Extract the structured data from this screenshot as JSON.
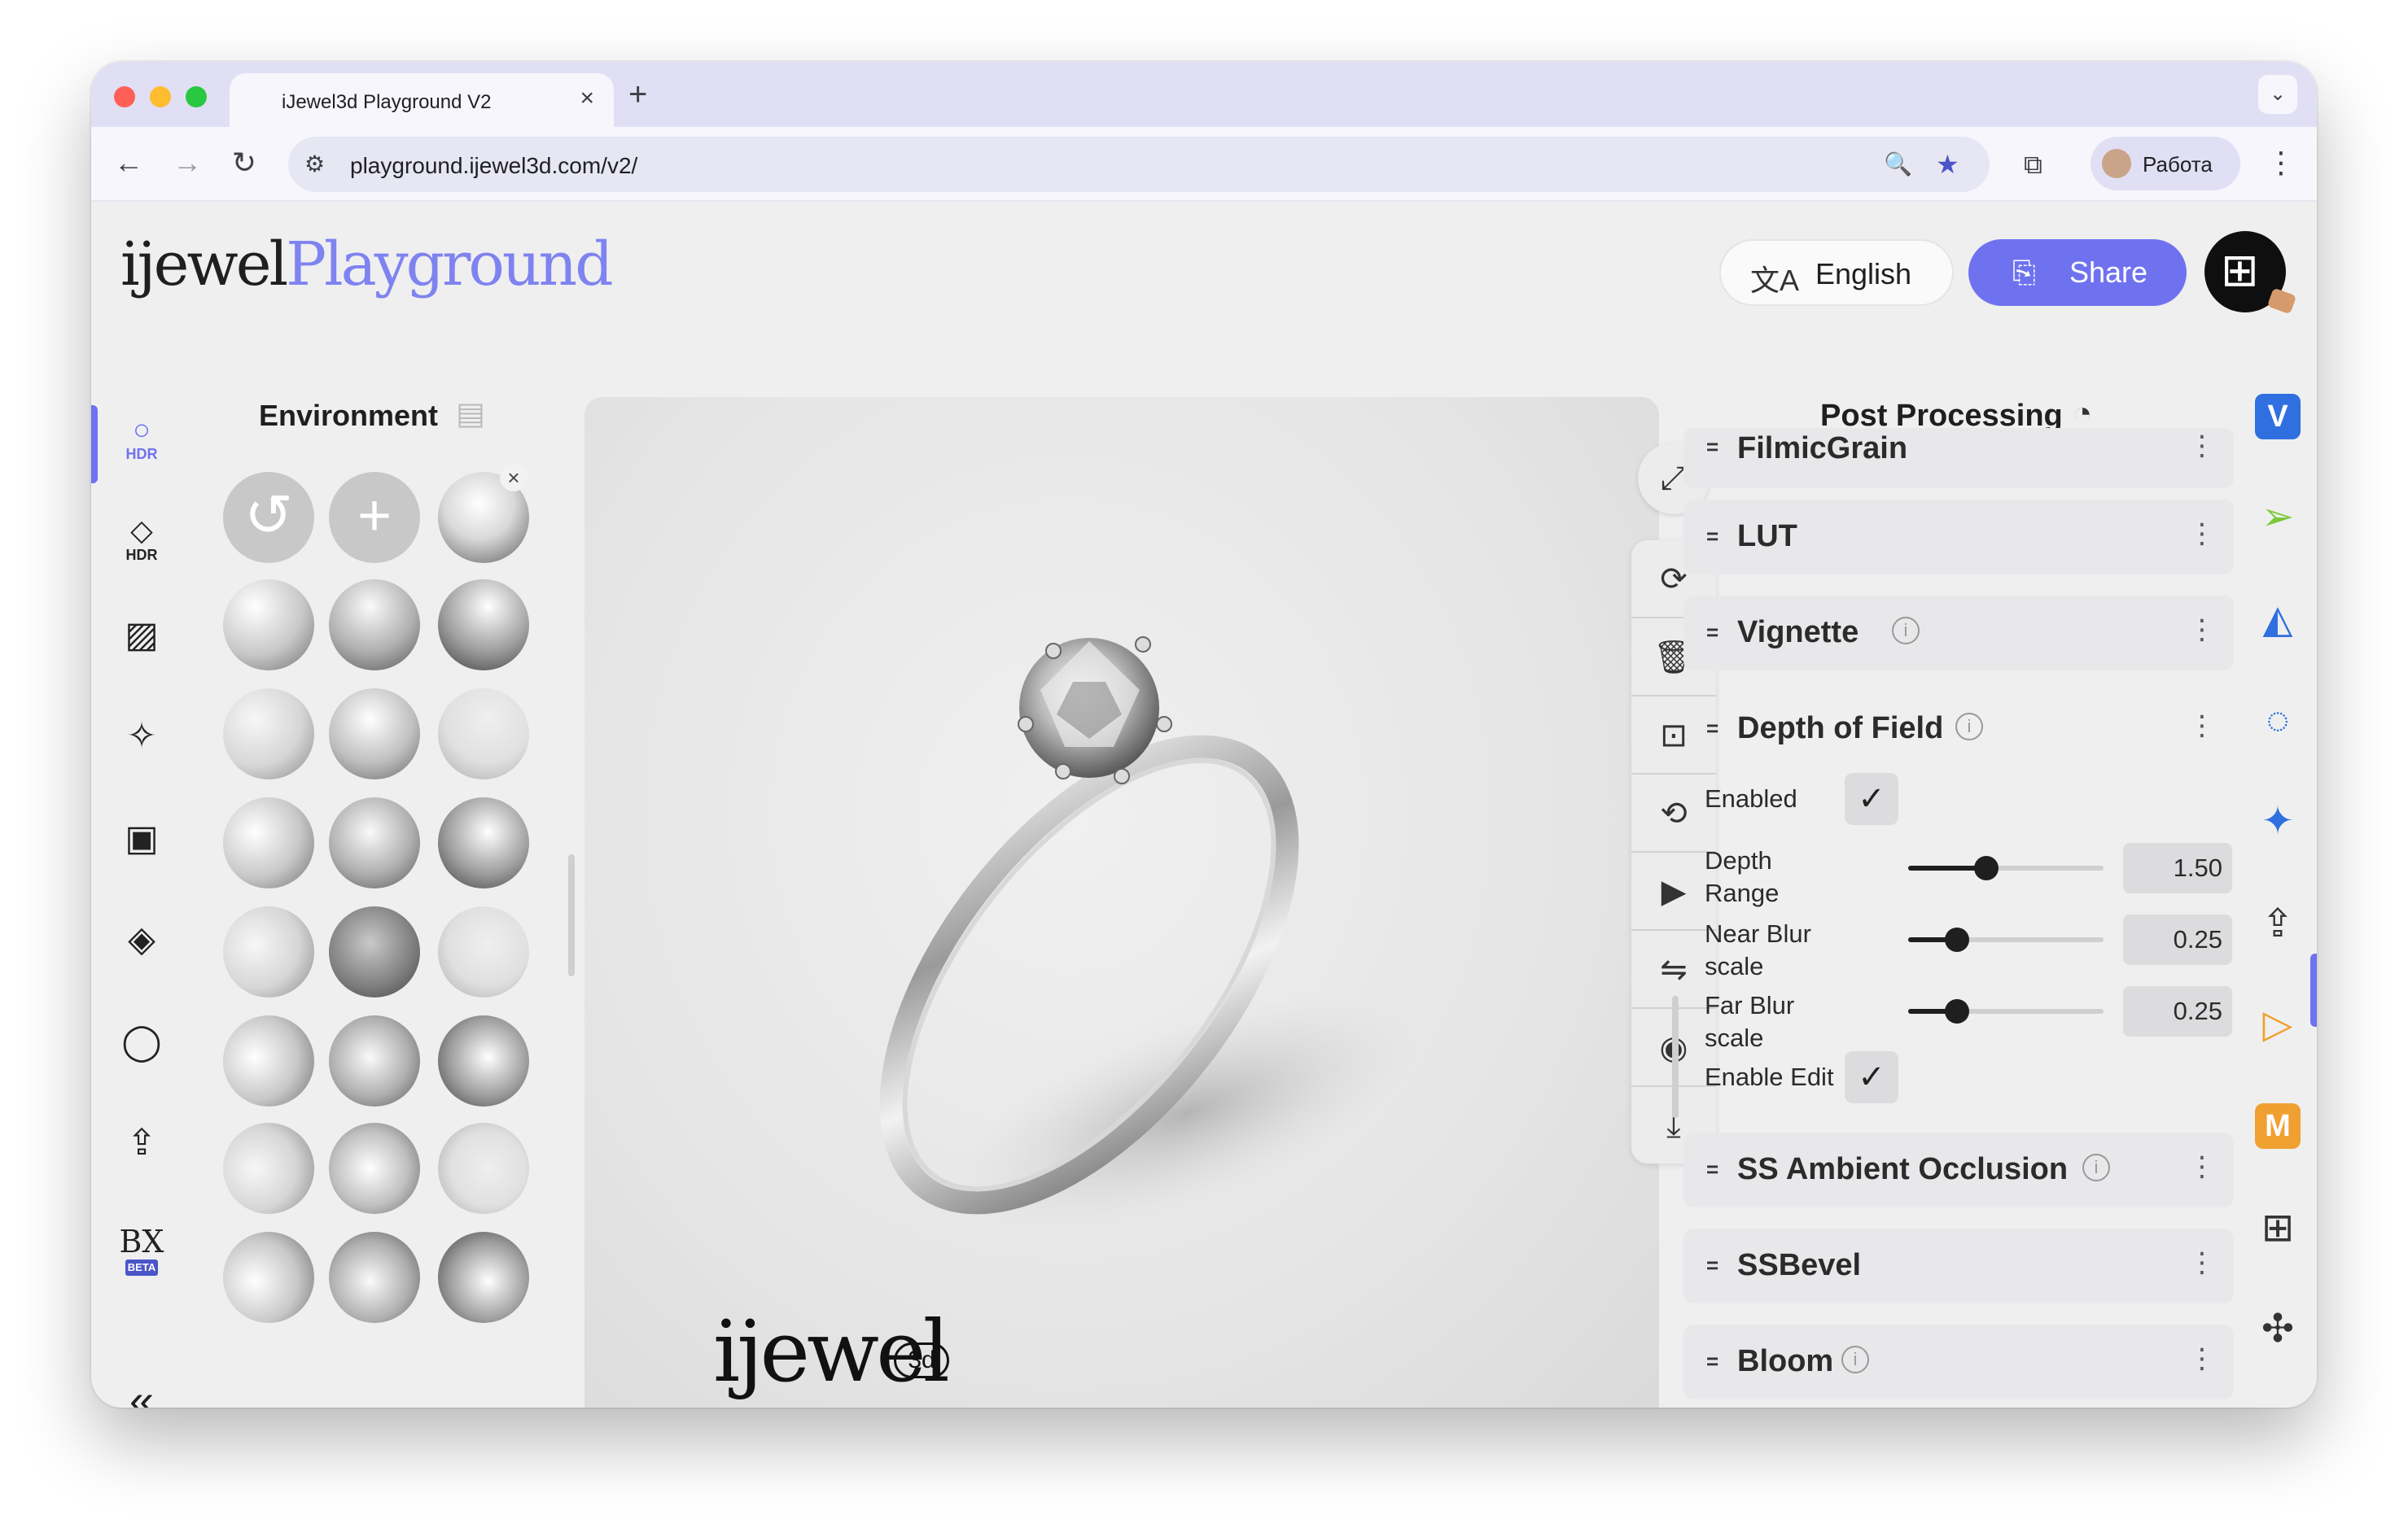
{
  "browser": {
    "tab_title": "iJewel3d Playground V2",
    "tab_close": "×",
    "new_tab": "+",
    "tabs_dropdown": "⌄",
    "url": "playground.ijewel3d.com/v2/",
    "profile_name": "Работа",
    "back": "←",
    "forward": "→",
    "reload": "↻",
    "site_info": "⚙",
    "zoom_icon": "🔍",
    "star_icon": "★",
    "extensions_icon": "⧉",
    "menu": "⋮"
  },
  "header": {
    "logo_part1": "ijewel",
    "logo_part2": "Playground",
    "language_icon": "文A",
    "language_label": "English",
    "share_icon": "⎘",
    "share_label": "Share",
    "avatar_glyph": "⊞"
  },
  "left_rail": [
    {
      "glyph": "○",
      "text": "HDR"
    },
    {
      "glyph": "◇",
      "text": "HDR"
    },
    {
      "glyph": "▨",
      "text": ""
    },
    {
      "glyph": "✧",
      "text": ""
    },
    {
      "glyph": "▣",
      "text": ""
    },
    {
      "glyph": "◈",
      "text": ""
    },
    {
      "glyph": "◯",
      "text": ""
    },
    {
      "glyph": "⇪",
      "text": ""
    },
    {
      "glyph": "BX",
      "text": "BETA"
    }
  ],
  "left_rail_collapse": "«",
  "environment": {
    "title": "Environment",
    "title_icon": "▤",
    "reset_icon": "↺",
    "add_icon": "+",
    "remove_icon": "×"
  },
  "viewport": {
    "fullscreen_icon": "⤢",
    "tools": [
      {
        "name": "rotate-tool",
        "glyph": "⟳"
      },
      {
        "name": "delete-tool",
        "glyph": "🗑"
      },
      {
        "name": "focus-tool",
        "glyph": "⊡"
      },
      {
        "name": "autorotate-tool",
        "glyph": "⟲"
      },
      {
        "name": "play-tool",
        "glyph": "▶"
      },
      {
        "name": "mirror-tool",
        "glyph": "⇋"
      },
      {
        "name": "camera-tool",
        "glyph": "◉"
      },
      {
        "name": "download-tool",
        "glyph": "⤓"
      }
    ],
    "brand": "ijewel",
    "brand_badge": "3d"
  },
  "post_processing": {
    "title": "Post Processing",
    "title_icon": "◔",
    "drag_glyph": "=",
    "info_glyph": "i",
    "menu_glyph": "⋮",
    "sections": [
      {
        "label": "FilmicGrain",
        "info": false
      },
      {
        "label": "LUT",
        "info": false
      },
      {
        "label": "Vignette",
        "info": true
      },
      {
        "label": "Depth of Field",
        "info": true,
        "expanded": true
      },
      {
        "label": "SS Ambient Occlusion",
        "info": true
      },
      {
        "label": "SSBevel",
        "info": false
      },
      {
        "label": "Bloom",
        "info": true
      }
    ],
    "dof": {
      "enabled_label": "Enabled",
      "enabled": true,
      "check_glyph": "✓",
      "sliders": [
        {
          "label": "Depth Range",
          "value": "1.50",
          "fraction": 0.4
        },
        {
          "label": "Near Blur scale",
          "value": "0.25",
          "fraction": 0.25
        },
        {
          "label": "Far Blur scale",
          "value": "0.25",
          "fraction": 0.25
        }
      ],
      "enable_edit_label": "Enable Edit",
      "enable_edit": true
    }
  },
  "right_rail": [
    {
      "name": "v-plugin-icon",
      "glyph": "V",
      "color": "#2f6fe0"
    },
    {
      "name": "cursor-icon",
      "glyph": "➢",
      "color": "#7cc83a"
    },
    {
      "name": "shapes-icon",
      "glyph": "◭",
      "color": "#2f6fe0"
    },
    {
      "name": "loader-icon",
      "glyph": "◌",
      "color": "#2f6fe0"
    },
    {
      "name": "sparkle-icon",
      "glyph": "✦",
      "color": "#2f6fe0"
    },
    {
      "name": "upload-icon",
      "glyph": "⇪",
      "color": "#333333"
    },
    {
      "name": "play-icon",
      "glyph": "▷",
      "color": "#f0a030"
    },
    {
      "name": "m-plugin-icon",
      "glyph": "M",
      "color": "#f0a030"
    },
    {
      "name": "grid-icon",
      "glyph": "⊞",
      "color": "#333333"
    },
    {
      "name": "puzzle-icon",
      "glyph": "✣",
      "color": "#333333"
    }
  ],
  "colors": {
    "accent": "#6f72ef",
    "app_background": "#efeff0",
    "tabstrip": "#e1dff4"
  }
}
